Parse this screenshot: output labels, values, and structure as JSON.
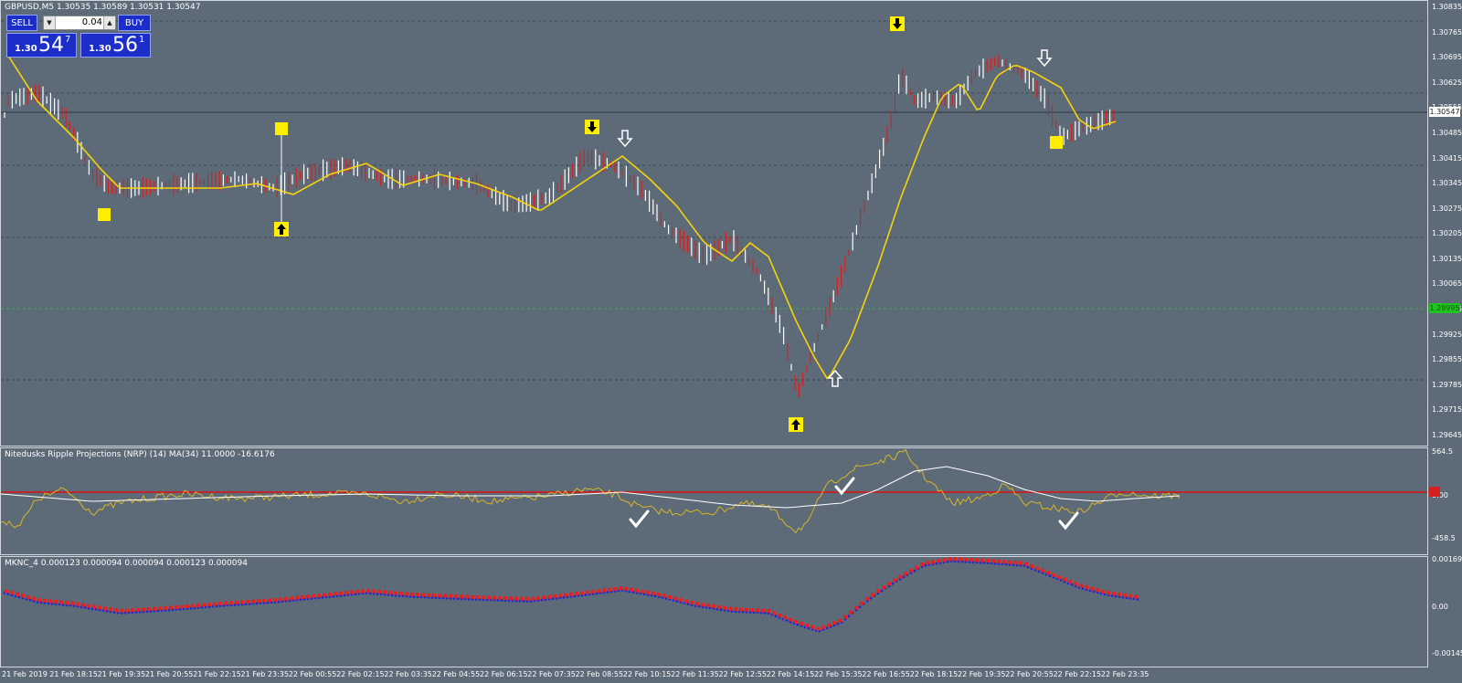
{
  "main": {
    "header": "GBPUSD,M5  1.30535 1.30589 1.30531 1.30547",
    "price_axis": [
      "1.30835",
      "1.30765",
      "1.30695",
      "1.30625",
      "1.30555",
      "1.30485",
      "1.30415",
      "1.30345",
      "1.30275",
      "1.30205",
      "1.30135",
      "1.30065",
      "1.29995",
      "1.29925",
      "1.29855",
      "1.29785",
      "1.29715",
      "1.29645"
    ],
    "current_price_tag": "1.30547",
    "green_line_tag": "1.29995",
    "colors": {
      "background": "#5d6b78",
      "bull": "#ffffff",
      "bear": "#d42020",
      "ma": "#f5d20a",
      "signal_box": "#ffee00",
      "grid": "#3b4650",
      "green_line": "#22c222"
    }
  },
  "trade_panel": {
    "sell_label": "SELL",
    "buy_label": "BUY",
    "lot_value": "0.04",
    "lot_down_icon": "triangle-down",
    "lot_up_icon": "triangle-up",
    "sell_prefix": "1.30",
    "sell_big": "54",
    "sell_sup": "7",
    "buy_prefix": "1.30",
    "buy_big": "56",
    "buy_sup": "1"
  },
  "nrp": {
    "header": "Nitedusks Ripple Projections (NRP) (14) MA(34) 11.0000 -16.6176",
    "axis": [
      "564.5",
      "0.00",
      "-458.5"
    ],
    "colors": {
      "line": "#d8b426",
      "ma": "#ffffff",
      "zero": "#e01010"
    }
  },
  "mknc": {
    "header": "MKNC_4 0.000123 0.000094 0.000094 0.000123 0.000094",
    "axis": [
      "0.001691",
      "0.00",
      "-0.001459"
    ],
    "colors": {
      "fast": "#e82020",
      "slow": "#2028d0"
    }
  },
  "time_axis": [
    "21 Feb 2019",
    "21 Feb 18:15",
    "21 Feb 19:35",
    "21 Feb 20:55",
    "21 Feb 22:15",
    "21 Feb 23:35",
    "22 Feb 00:55",
    "22 Feb 02:15",
    "22 Feb 03:35",
    "22 Feb 04:55",
    "22 Feb 06:15",
    "22 Feb 07:35",
    "22 Feb 08:55",
    "22 Feb 10:15",
    "22 Feb 11:35",
    "22 Feb 12:55",
    "22 Feb 14:15",
    "22 Feb 15:35",
    "22 Feb 16:55",
    "22 Feb 18:15",
    "22 Feb 19:35",
    "22 Feb 20:55",
    "22 Feb 22:15",
    "22 Feb 23:35"
  ]
}
